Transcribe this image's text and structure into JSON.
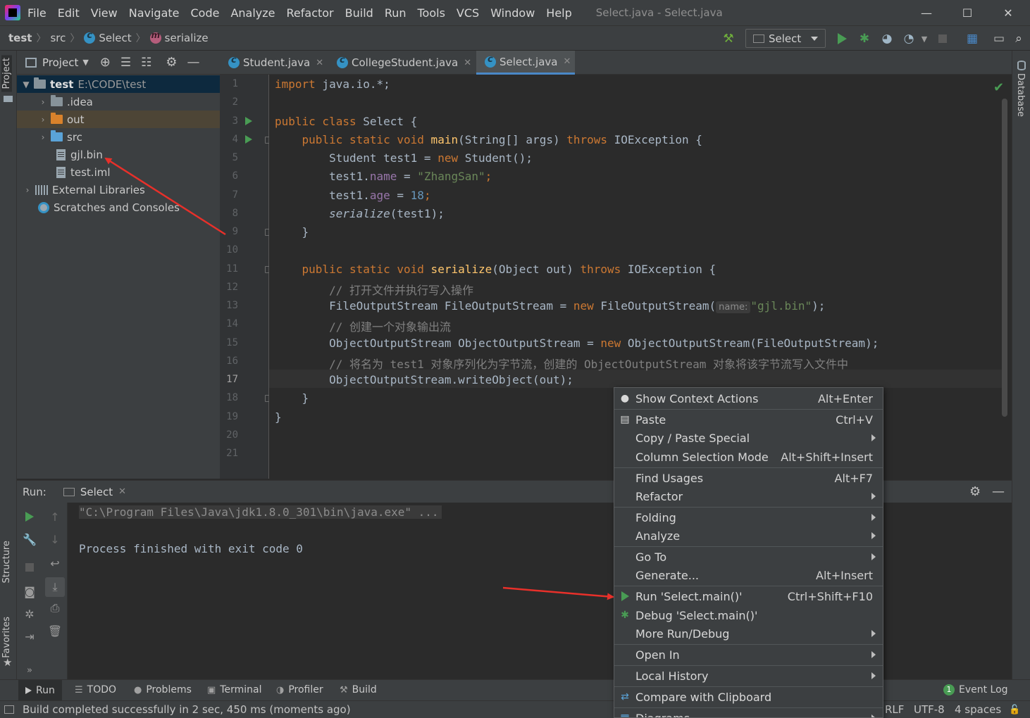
{
  "window": {
    "title": "Select.java - Select.java",
    "minimize": "—",
    "maximize": "☐",
    "close": "✕"
  },
  "menu": [
    "File",
    "Edit",
    "View",
    "Navigate",
    "Code",
    "Analyze",
    "Refactor",
    "Build",
    "Run",
    "Tools",
    "VCS",
    "Window",
    "Help"
  ],
  "breadcrumb": {
    "project": "test",
    "folder": "src",
    "class": "Select",
    "method": "serialize"
  },
  "toolbar": {
    "run_config": "Select"
  },
  "side_tabs": {
    "project": "Project",
    "structure": "Structure",
    "favorites": "Favorites",
    "database": "Database"
  },
  "project_pane": {
    "title": "Project",
    "tree": {
      "root_name": "test",
      "root_path": "E:\\CODE\\test",
      "idea": ".idea",
      "out": "out",
      "src": "src",
      "gjl_bin": "gjl.bin",
      "test_iml": "test.iml",
      "external_libraries": "External Libraries",
      "scratches": "Scratches and Consoles"
    }
  },
  "editor_tabs": {
    "student": "Student.java",
    "college": "CollegeStudent.java",
    "select": "Select.java"
  },
  "editor": {
    "line_numbers": [
      "1",
      "2",
      "3",
      "4",
      "5",
      "6",
      "7",
      "8",
      "9",
      "10",
      "11",
      "12",
      "13",
      "14",
      "15",
      "16",
      "17",
      "18",
      "19",
      "20",
      "21"
    ],
    "current_line": "17",
    "code": {
      "l1_kw": "import",
      "l1_rest": " java.io.*;",
      "l3_kw": "public class",
      "l3_rest": " Select {",
      "l4_kw1": "    public static void",
      "l4_fn": " main",
      "l4_mid": "(String[] args) ",
      "l4_kw2": "throws",
      "l4_end": " IOException {",
      "l5_a": "        Student test1 = ",
      "l5_kw": "new",
      "l5_b": " Student();",
      "l6_a": "        test1.",
      "l6_fld": "name",
      "l6_b": " = ",
      "l6_str": "\"ZhangSan\"",
      "l6_c": ";",
      "l7_a": "        test1.",
      "l7_fld": "age",
      "l7_b": " = ",
      "l7_num": "18",
      "l7_c": ";",
      "l8_a": "        ",
      "l8_it": "serialize",
      "l8_b": "(test1);",
      "l9": "    }",
      "l11_kw1": "    public static void",
      "l11_fn": " serialize",
      "l11_mid": "(Object out) ",
      "l11_kw2": "throws",
      "l11_end": " IOException {",
      "l12": "        // 打开文件并执行写入操作",
      "l13_a": "        FileOutputStream FileOutputStream = ",
      "l13_kw": "new",
      "l13_b": " FileOutputStream(",
      "l13_hint": "name:",
      "l13_str": "\"gjl.bin\"",
      "l13_c": ");",
      "l14": "        // 创建一个对象输出流",
      "l15_a": "        ObjectOutputStream ObjectOutputStream = ",
      "l15_kw": "new",
      "l15_b": " ObjectOutputStream(FileOutputStream);",
      "l16": "        // 将名为 test1 对象序列化为字节流，创建的 ObjectOutputStream 对象将该字节流写入文件中",
      "l17": "        ObjectOutputStream.writeObject(out);",
      "l18": "    }",
      "l19": "}"
    }
  },
  "run_panel": {
    "label": "Run:",
    "tab": "Select",
    "console": {
      "cmd": "\"C:\\Program Files\\Java\\jdk1.8.0_301\\bin\\java.exe\" ...",
      "exit": "Process finished with exit code 0"
    }
  },
  "context_menu": {
    "show_context_actions": {
      "label": "Show Context Actions",
      "shortcut": "Alt+Enter"
    },
    "paste": {
      "label": "Paste",
      "shortcut": "Ctrl+V"
    },
    "copy_paste_special": {
      "label": "Copy / Paste Special"
    },
    "column_selection_mode": {
      "label": "Column Selection Mode",
      "shortcut": "Alt+Shift+Insert"
    },
    "find_usages": {
      "label": "Find Usages",
      "shortcut": "Alt+F7"
    },
    "refactor": {
      "label": "Refactor"
    },
    "folding": {
      "label": "Folding"
    },
    "analyze": {
      "label": "Analyze"
    },
    "go_to": {
      "label": "Go To"
    },
    "generate": {
      "label": "Generate...",
      "shortcut": "Alt+Insert"
    },
    "run": {
      "label": "Run 'Select.main()'",
      "shortcut": "Ctrl+Shift+F10"
    },
    "debug": {
      "label": "Debug 'Select.main()'"
    },
    "more_run_debug": {
      "label": "More Run/Debug"
    },
    "open_in": {
      "label": "Open In"
    },
    "local_history": {
      "label": "Local History"
    },
    "compare_clipboard": {
      "label": "Compare with Clipboard"
    },
    "diagrams": {
      "label": "Diagrams"
    }
  },
  "tool_windows": {
    "run": "Run",
    "todo": "TODO",
    "problems": "Problems",
    "terminal": "Terminal",
    "profiler": "Profiler",
    "build": "Build",
    "event_log_count": "1",
    "event_log": "Event Log"
  },
  "status": {
    "message": "Build completed successfully in 2 sec, 450 ms (moments ago)",
    "line_sep": "RLF",
    "encoding": "UTF-8",
    "indent": "4 spaces"
  },
  "colors": {
    "accent": "#4a88c7",
    "run_green": "#499c54",
    "annotation_red": "#e8302a"
  }
}
